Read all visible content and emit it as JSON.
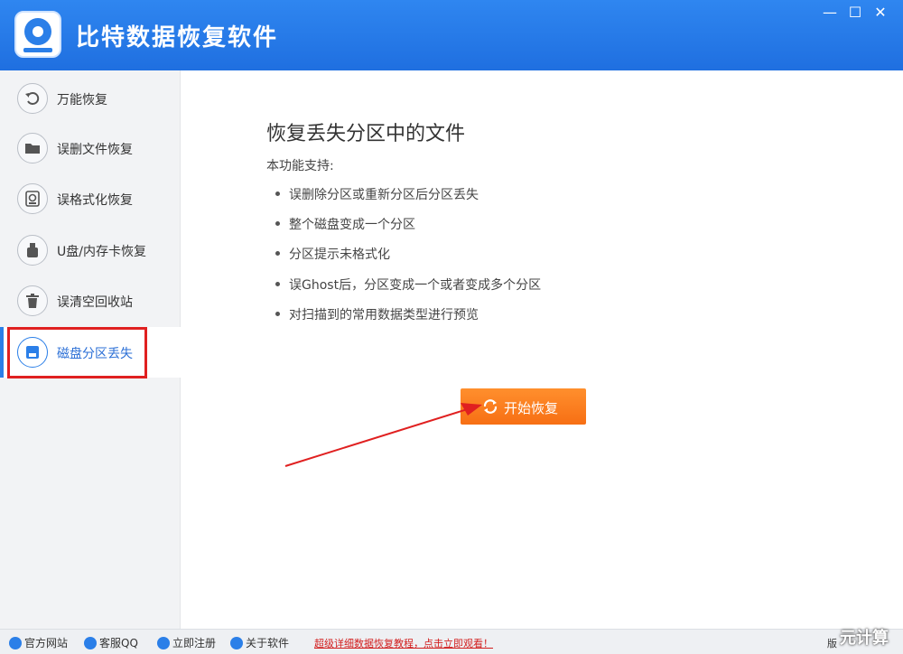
{
  "app": {
    "title": "比特数据恢复软件"
  },
  "window_controls": {
    "min": "—",
    "max": "☐",
    "close": "✕"
  },
  "sidebar": {
    "items": [
      {
        "label": "万能恢复",
        "icon": "undo-icon"
      },
      {
        "label": "误删文件恢复",
        "icon": "folder-icon"
      },
      {
        "label": "误格式化恢复",
        "icon": "format-disk-icon"
      },
      {
        "label": "U盘/内存卡恢复",
        "icon": "usb-drive-icon"
      },
      {
        "label": "误清空回收站",
        "icon": "trash-icon"
      },
      {
        "label": "磁盘分区丢失",
        "icon": "disk-icon"
      }
    ],
    "active_index": 5
  },
  "main": {
    "title": "恢复丢失分区中的文件",
    "subtitle": "本功能支持:",
    "features": [
      "误删除分区或重新分区后分区丢失",
      "整个磁盘变成一个分区",
      "分区提示未格式化",
      "误Ghost后，分区变成一个或者变成多个分区",
      "对扫描到的常用数据类型进行预览"
    ],
    "start_button": "开始恢复"
  },
  "statusbar": {
    "official_site": "官方网站",
    "service_qq": "客服QQ",
    "register": "立即注册",
    "about": "关于软件",
    "tutorial_link": "超级详细数据恢复教程，点击立即观看！",
    "version_label": "版"
  },
  "watermark": "元计算",
  "colors": {
    "accent": "#2b7fe8",
    "orange": "#f7801f",
    "highlight": "#e02020"
  }
}
